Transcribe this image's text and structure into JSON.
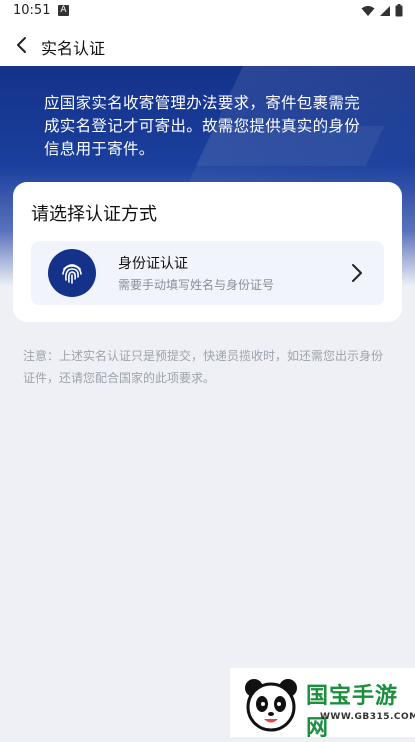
{
  "status_bar": {
    "time": "10:51",
    "notification_icon": "A"
  },
  "header": {
    "title": "实名认证"
  },
  "banner": {
    "text": "应国家实名收寄管理办法要求，寄件包裹需完成实名登记才可寄出。故需您提供真实的身份信息用于寄件。"
  },
  "card": {
    "title": "请选择认证方式",
    "option": {
      "title": "身份证认证",
      "subtitle": "需要手动填写姓名与身份证号",
      "icon": "fingerprint-icon"
    }
  },
  "note": "注意：上述实名认证只是预提交，快递员揽收时，如还需您出示身份证件，还请您配合国家的此项要求。",
  "watermark": {
    "brand": "国宝手游网",
    "url": "WWW.GB315.COM"
  },
  "colors": {
    "brand_blue": "#14328a",
    "background": "#eef0f5",
    "option_bg": "#f2f4fc"
  }
}
